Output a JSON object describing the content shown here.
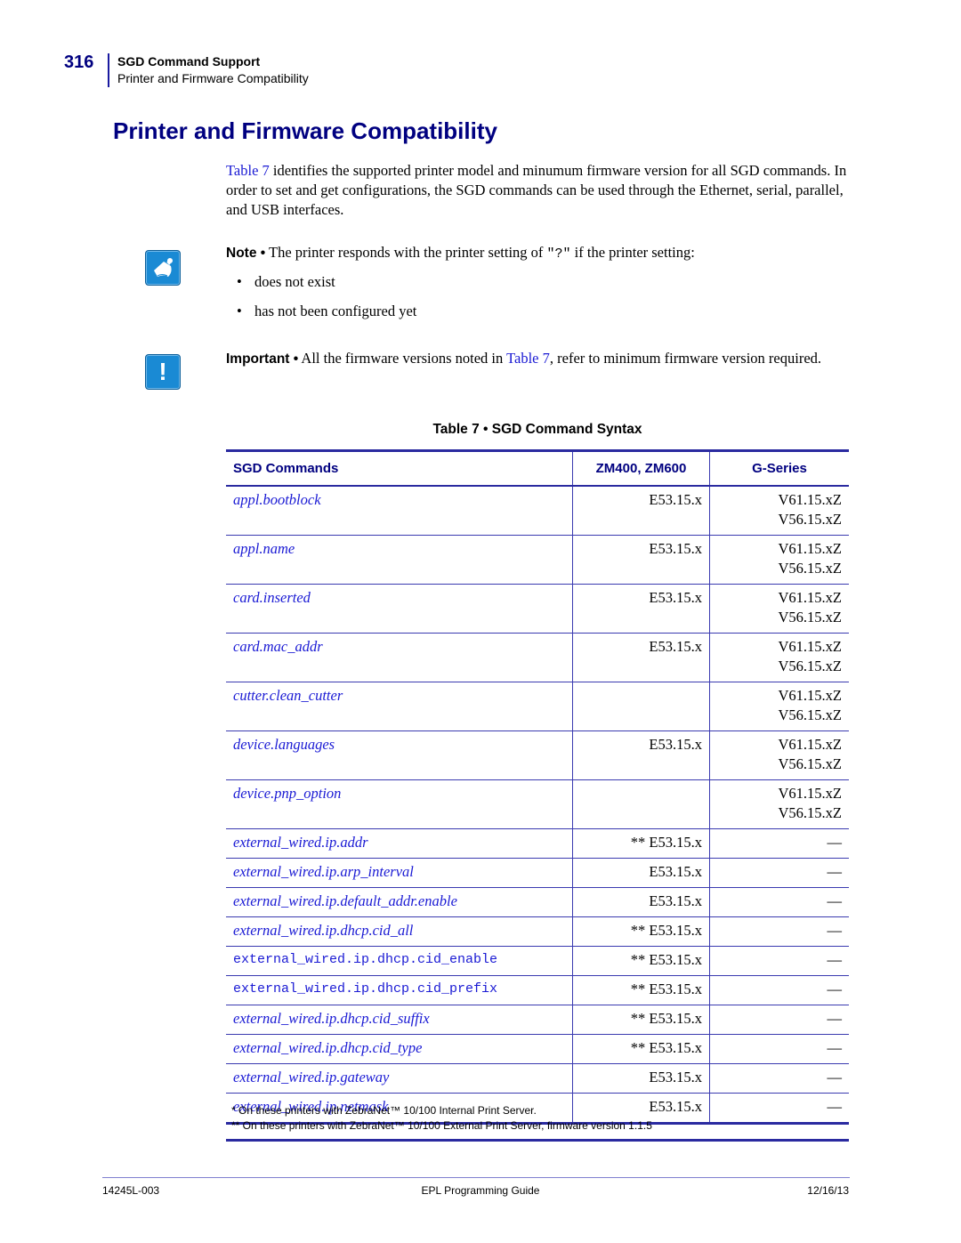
{
  "header": {
    "page_number": "316",
    "chapter": "SGD Command Support",
    "section": "Printer and Firmware Compatibility"
  },
  "title": "Printer and Firmware Compatibility",
  "intro": {
    "link": "Table 7",
    "text": " identifies the supported printer model and minumum firmware version for all SGD commands. In order to set and get configurations, the SGD commands can be used through the Ethernet, serial, parallel, and USB interfaces."
  },
  "note": {
    "icon": "note-pad-icon",
    "label": "Note •",
    "text_before": " The printer responds with the printer setting of ",
    "code": "\"?\"",
    "text_after": " if the printer setting:",
    "bullets": [
      "does not exist",
      "has not been configured yet"
    ],
    "bullet_glyph": "•"
  },
  "important": {
    "icon": "exclamation-icon",
    "glyph": "!",
    "label": "Important •",
    "text_before": " All the firmware versions noted in ",
    "link": "Table 7",
    "text_after": ", refer to minimum firmware version required."
  },
  "table": {
    "caption": "Table 7 • SGD Command Syntax",
    "headers": [
      "SGD Commands",
      "ZM400, ZM600",
      "G-Series"
    ],
    "rows": [
      {
        "command": "appl.bootblock",
        "zm": "E53.15.x",
        "g": [
          "V61.15.xZ",
          "V56.15.xZ"
        ]
      },
      {
        "command": "appl.name",
        "zm": "E53.15.x",
        "g": [
          "V61.15.xZ",
          "V56.15.xZ"
        ]
      },
      {
        "command": "card.inserted",
        "zm": "E53.15.x",
        "g": [
          "V61.15.xZ",
          "V56.15.xZ"
        ]
      },
      {
        "command": "card.mac_addr",
        "zm": "E53.15.x",
        "g": [
          "V61.15.xZ",
          "V56.15.xZ"
        ]
      },
      {
        "command": "cutter.clean_cutter",
        "zm": "",
        "g": [
          "V61.15.xZ",
          "V56.15.xZ"
        ]
      },
      {
        "command": "device.languages",
        "zm": "E53.15.x",
        "g": [
          "V61.15.xZ",
          "V56.15.xZ"
        ]
      },
      {
        "command": "device.pnp_option",
        "zm": "",
        "g": [
          "V61.15.xZ",
          "V56.15.xZ"
        ]
      },
      {
        "command": "external_wired.ip.addr",
        "zm": "** E53.15.x",
        "g": [
          "—"
        ]
      },
      {
        "command": "external_wired.ip.arp_interval",
        "zm": "E53.15.x",
        "g": [
          "—"
        ]
      },
      {
        "command": "external_wired.ip.default_addr.enable",
        "zm": "E53.15.x",
        "g": [
          "—"
        ]
      },
      {
        "command": "external_wired.ip.dhcp.cid_all",
        "zm": "** E53.15.x",
        "g": [
          "—"
        ]
      },
      {
        "command": "external_wired.ip.dhcp.cid_enable",
        "zm": "** E53.15.x",
        "g": [
          "—"
        ],
        "mono": true
      },
      {
        "command": "external_wired.ip.dhcp.cid_prefix",
        "zm": "** E53.15.x",
        "g": [
          "—"
        ],
        "mono": true
      },
      {
        "command": "external_wired.ip.dhcp.cid_suffix",
        "zm": "** E53.15.x",
        "g": [
          "—"
        ]
      },
      {
        "command": "external_wired.ip.dhcp.cid_type",
        "zm": "** E53.15.x",
        "g": [
          "—"
        ]
      },
      {
        "command": "external_wired.ip.gateway",
        "zm": "E53.15.x",
        "g": [
          "—"
        ]
      },
      {
        "command": "external_wired.ip.netmask",
        "zm": "E53.15.x",
        "g": [
          "—"
        ]
      }
    ],
    "footnotes": [
      "* On these printers with ZebraNet™ 10/100 Internal Print Server.",
      "** On these printers with ZebraNet™ 10/100 External Print Server, firmware version 1.1.5"
    ]
  },
  "footer": {
    "doc_id": "14245L-003",
    "doc_title": "EPL Programming Guide",
    "date": "12/16/13"
  }
}
